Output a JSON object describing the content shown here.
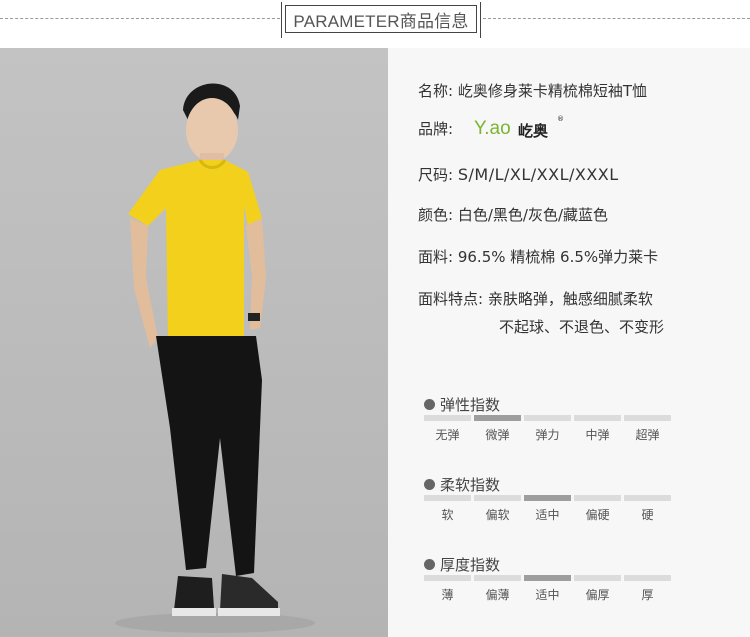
{
  "header": {
    "title": "PARAMETER商品信息"
  },
  "product": {
    "name_label": "名称:",
    "name_value": "屹奥修身莱卡精梳棉短袖T恤",
    "brand_label": "品牌:",
    "brand_logo_latin": "Y.ao",
    "brand_logo_cn": "屹奥",
    "brand_logo_reg": "®",
    "size_label": "尺码:",
    "size_value": "S/M/L/XL/XXL/XXXL",
    "color_label": "颜色:",
    "color_value": "白色/黑色/灰色/藏蓝色",
    "fabric_label": "面料:",
    "fabric_value": "96.5% 精梳棉  6.5%弹力莱卡",
    "feature_label": "面料特点:",
    "feature_line1": "亲肤略弹，触感细腻柔软",
    "feature_line2": "不起球、不退色、不变形"
  },
  "indices": [
    {
      "title": "弹性指数",
      "options": [
        "无弹",
        "微弹",
        "弹力",
        "中弹",
        "超弹"
      ],
      "selected": 1
    },
    {
      "title": "柔软指数",
      "options": [
        "软",
        "偏软",
        "适中",
        "偏硬",
        "硬"
      ],
      "selected": 2
    },
    {
      "title": "厚度指数",
      "options": [
        "薄",
        "偏薄",
        "适中",
        "偏厚",
        "厚"
      ],
      "selected": 2
    }
  ],
  "colors": {
    "shirt": "#f2d01c",
    "pants": "#141414",
    "background_photo": "#bcbcbc",
    "panel": "#f7f7f7",
    "bar_on": "#9e9e9e",
    "bar_off": "#dcdcdc"
  }
}
